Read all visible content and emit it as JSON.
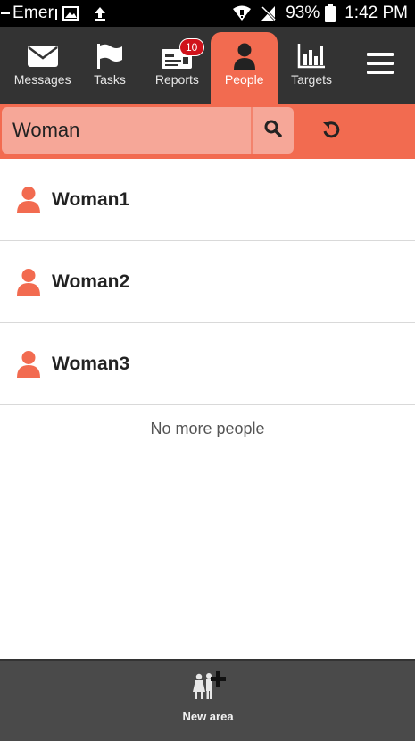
{
  "status_bar": {
    "notification_text": "Emer",
    "battery": "93%",
    "time": "1:42 PM"
  },
  "nav": {
    "tabs": [
      {
        "label": "Messages",
        "icon": "envelope-icon"
      },
      {
        "label": "Tasks",
        "icon": "flag-icon"
      },
      {
        "label": "Reports",
        "icon": "report-icon",
        "badge": "10"
      },
      {
        "label": "People",
        "icon": "person-icon",
        "active": true
      },
      {
        "label": "Targets",
        "icon": "bar-chart-icon"
      }
    ],
    "menu_icon": "hamburger-menu-icon"
  },
  "search": {
    "value": "Woman",
    "search_icon": "search-icon",
    "reset_icon": "reset-icon"
  },
  "people": [
    {
      "name": "Woman1"
    },
    {
      "name": "Woman2"
    },
    {
      "name": "Woman3"
    }
  ],
  "list_end_text": "No more people",
  "bottom_bar": {
    "new_area_label": "New area"
  },
  "colors": {
    "accent": "#f26b50",
    "nav_background": "#333333",
    "badge": "#d0121b"
  }
}
